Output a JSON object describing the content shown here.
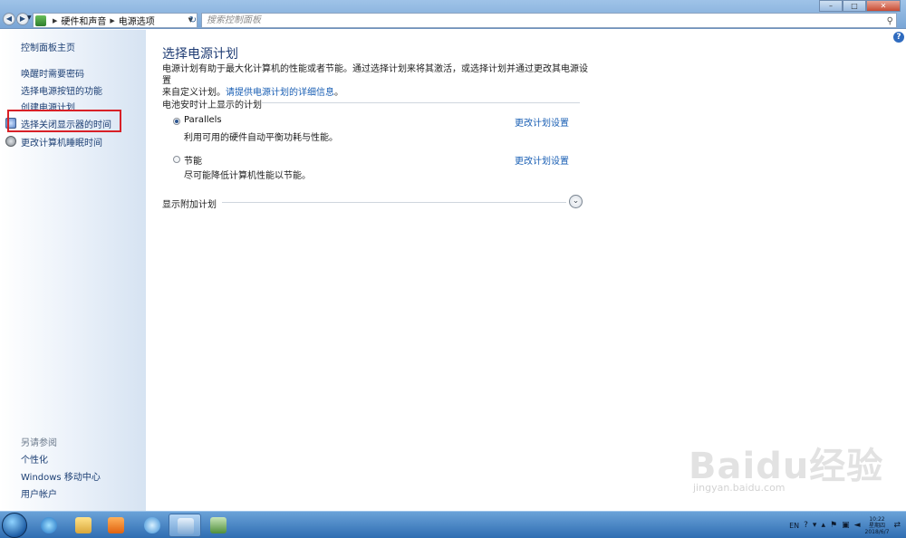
{
  "window": {
    "breadcrumbs": [
      "硬件和声音",
      "电源选项"
    ],
    "search_placeholder": "搜索控制面板"
  },
  "sidebar": {
    "home": "控制面板主页",
    "items": [
      "唤醒时需要密码",
      "选择电源按钮的功能",
      "创建电源计划",
      "选择关闭显示器的时间",
      "更改计算机睡眠时间"
    ],
    "see_also_title": "另请参阅",
    "see_also": [
      "个性化",
      "Windows 移动中心",
      "用户帐户"
    ]
  },
  "main": {
    "title": "选择电源计划",
    "description_line1": "电源计划有助于最大化计算机的性能或者节能。通过选择计划来将其激活，或选择计划并通过更改其电源设置",
    "description_line2": "来自定义计划。",
    "description_link": "请提供电源计划的详细信息",
    "description_end": "。",
    "group_title": "电池安时计上显示的计划",
    "plans": [
      {
        "name": "Parallels",
        "description": "利用可用的硬件自动平衡功耗与性能。",
        "link": "更改计划设置",
        "selected": true
      },
      {
        "name": "节能",
        "description": "尽可能降低计算机性能以节能。",
        "link": "更改计划设置",
        "selected": false
      }
    ],
    "more_plans": "显示附加计划"
  },
  "watermark": {
    "text": "Baidu经验",
    "sub": "jingyan.baidu.com"
  },
  "taskbar": {
    "language": "EN",
    "time": "10:22",
    "weekday": "星期四",
    "date": "2018/6/7"
  },
  "colors": {
    "accent": "#1a5fb4",
    "highlight": "#d82027"
  }
}
